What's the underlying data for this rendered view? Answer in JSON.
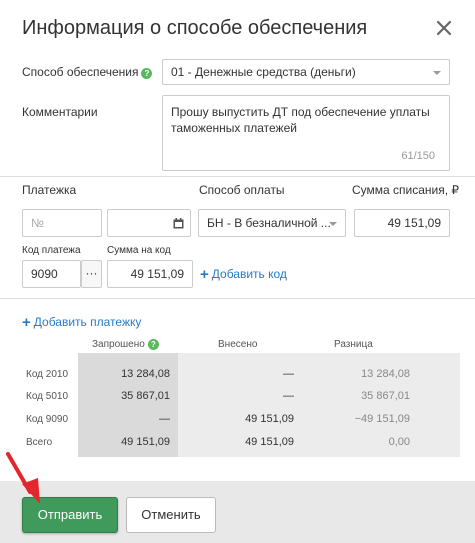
{
  "dialog": {
    "title": "Информация о способе обеспечения",
    "close_icon": "close-icon"
  },
  "form": {
    "method_label": "Способ обеспечения",
    "method_value": "01 - Денежные средства (деньги)",
    "comment_label": "Комментарии",
    "comment_value": "Прошу выпустить ДТ под обеспечение уплаты таможенных платежей",
    "comment_counter": "61/150"
  },
  "payment": {
    "col_payment": "Платежка",
    "col_method": "Способ оплаты",
    "col_amount": "Сумма списания, ₽",
    "number_placeholder": "№",
    "date_value": "",
    "method_value": "БН - В безналичной ...",
    "amount_value": "49 151,09",
    "code_label": "Код платежа",
    "code_sum_label": "Сумма на код",
    "code_value": "9090",
    "code_dots": "···",
    "code_sum_value": "49 151,09",
    "add_code": "Добавить код",
    "add_payment": "Добавить платежку"
  },
  "summary": {
    "headers": [
      "Запрошено",
      "Внесено",
      "Разница"
    ],
    "rows": [
      {
        "label": "Код 2010",
        "requested": "13 284,08",
        "paid": "—",
        "diff": "13 284,08"
      },
      {
        "label": "Код 5010",
        "requested": "35 867,01",
        "paid": "—",
        "diff": "35 867,01"
      },
      {
        "label": "Код 9090",
        "requested": "—",
        "paid": "49 151,09",
        "diff": "−49 151,09"
      },
      {
        "label": "Всего",
        "requested": "49 151,09",
        "paid": "49 151,09",
        "diff": "0,00"
      }
    ]
  },
  "footer": {
    "submit_label": "Отправить",
    "cancel_label": "Отменить"
  },
  "colors": {
    "primary": "#3f9a5c",
    "link": "#2a7bc4",
    "help": "#5cb85c",
    "arrow": "#e3262c"
  }
}
